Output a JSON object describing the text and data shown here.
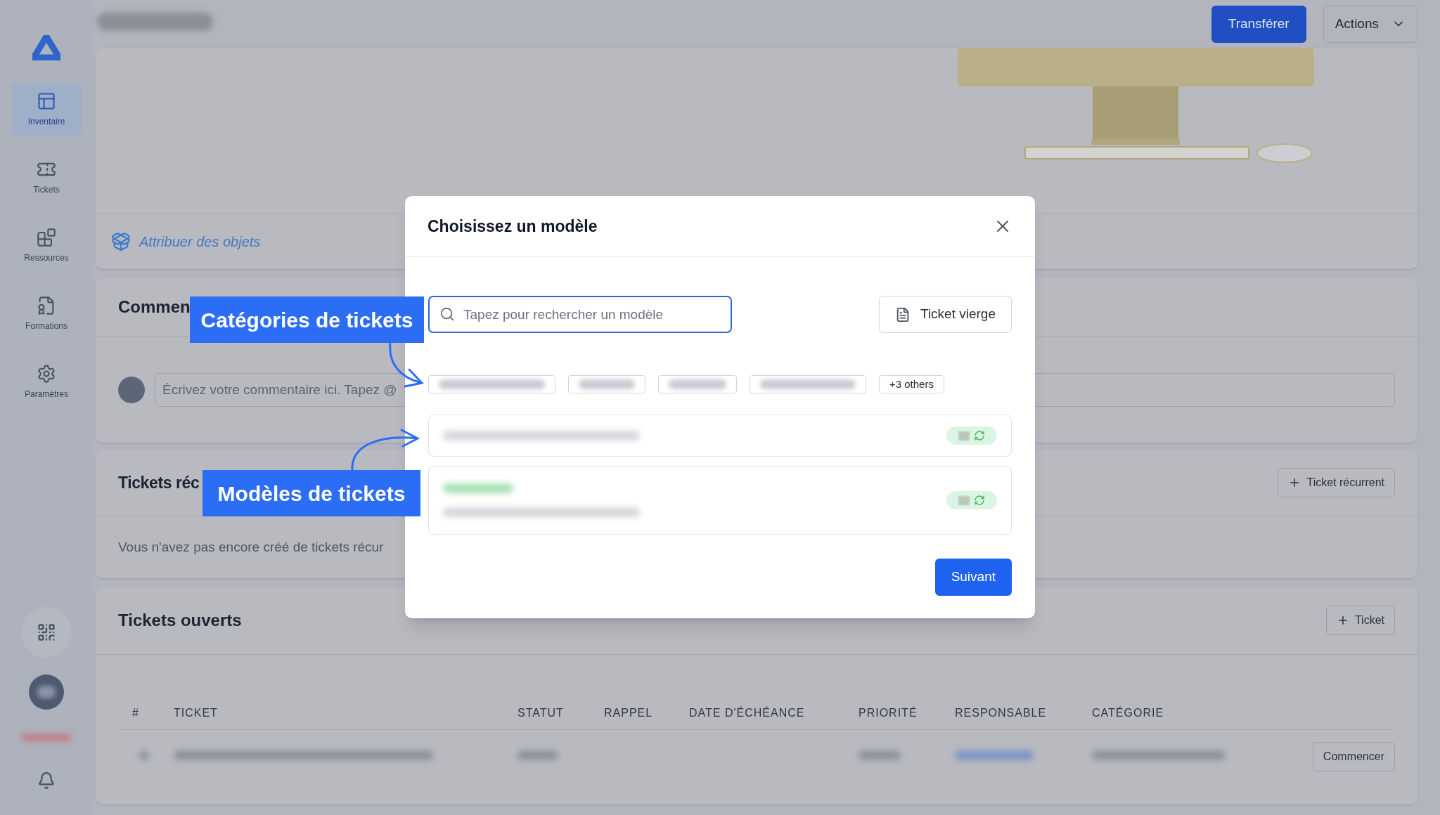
{
  "sidebar": {
    "items": [
      {
        "label": "Inventaire",
        "selected": true
      },
      {
        "label": "Tickets",
        "selected": false
      },
      {
        "label": "Ressources",
        "selected": false
      },
      {
        "label": "Formations",
        "selected": false
      },
      {
        "label": "Paramètres",
        "selected": false
      }
    ]
  },
  "header": {
    "transfer_button": "Transférer",
    "actions_button": "Actions"
  },
  "assign_link": "Attribuer des objets",
  "comments": {
    "title": "Commen",
    "placeholder": "Écrivez votre commentaire ici. Tapez @"
  },
  "recurring": {
    "title": "Tickets réc",
    "button": "Ticket récurrent",
    "empty_text": "Vous n'avez pas encore créé de tickets récur"
  },
  "open_tickets": {
    "title": "Tickets ouverts",
    "button": "Ticket",
    "columns": [
      "#",
      "TICKET",
      "STATUT",
      "RAPPEL",
      "DATE D'ÉCHÉANCE",
      "PRIORITÉ",
      "RESPONSABLE",
      "CATÉGORIE"
    ],
    "row_button": "Commencer"
  },
  "modal": {
    "title": "Choisissez un modèle",
    "search_placeholder": "Tapez pour rechercher un modèle",
    "blank_button": "Ticket vierge",
    "more_chip": "+3 others",
    "next_button": "Suivant"
  },
  "annotations": [
    {
      "label": "Catégories de tickets"
    },
    {
      "label": "Modèles de tickets"
    }
  ]
}
